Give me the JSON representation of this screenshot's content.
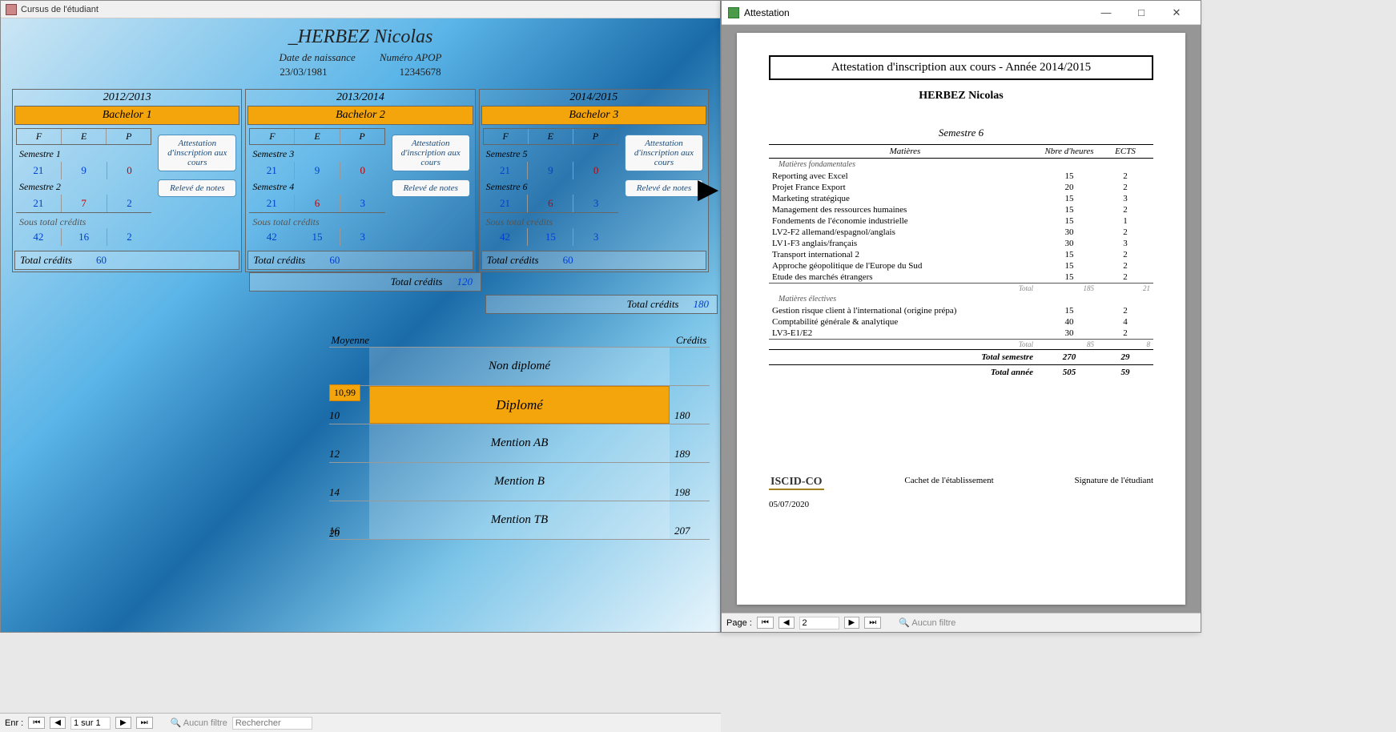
{
  "main": {
    "window_title": "Cursus de l'étudiant",
    "student_name": "_HERBEZ Nicolas",
    "dob_label": "Date de naissance",
    "dob_value": "23/03/1981",
    "apop_label": "Numéro APOP",
    "apop_value": "12345678",
    "years": [
      {
        "year": "2012/2013",
        "bach": "Bachelor 1",
        "sem_a": "Semestre 1",
        "sa_f": "21",
        "sa_e": "9",
        "sa_p": "0",
        "sem_b": "Semestre 2",
        "sb_f": "21",
        "sb_e": "7",
        "sb_p": "2",
        "sub_label": "Sous total crédits",
        "st_f": "42",
        "st_e": "16",
        "st_p": "2",
        "total_label": "Total crédits",
        "total": "60"
      },
      {
        "year": "2013/2014",
        "bach": "Bachelor 2",
        "sem_a": "Semestre 3",
        "sa_f": "21",
        "sa_e": "9",
        "sa_p": "0",
        "sem_b": "Semestre 4",
        "sb_f": "21",
        "sb_e": "6",
        "sb_p": "3",
        "sub_label": "Sous total crédits",
        "st_f": "42",
        "st_e": "15",
        "st_p": "3",
        "total_label": "Total crédits",
        "total": "60"
      },
      {
        "year": "2014/2015",
        "bach": "Bachelor 3",
        "sem_a": "Semestre 5",
        "sa_f": "21",
        "sa_e": "9",
        "sa_p": "0",
        "sem_b": "Semestre 6",
        "sb_f": "21",
        "sb_e": "6",
        "sb_p": "3",
        "sub_label": "Sous total crédits",
        "st_f": "42",
        "st_e": "15",
        "st_p": "3",
        "total_label": "Total crédits",
        "total": "60"
      }
    ],
    "fep": {
      "f": "F",
      "e": "E",
      "p": "P"
    },
    "btn_attest": "Attestation d'inscription aux cours",
    "btn_releve": "Relevé de notes",
    "cum120_label": "Total crédits",
    "cum120_val": "120",
    "cum180_label": "Total crédits",
    "cum180_val": "180",
    "ladder_hdr_l": "Moyenne",
    "ladder_hdr_r": "Crédits",
    "moy_badge": "10,99",
    "ladder": [
      {
        "left": "",
        "center": "Non diplomé",
        "right": "",
        "hi": false
      },
      {
        "left": "10",
        "center": "Diplomé",
        "right": "180",
        "hi": true
      },
      {
        "left": "12",
        "center": "Mention AB",
        "right": "189",
        "hi": false
      },
      {
        "left": "14",
        "center": "Mention B",
        "right": "198",
        "hi": false
      },
      {
        "left": "16",
        "center": "Mention TB",
        "right": "207",
        "hi": false
      },
      {
        "left": "20",
        "center": "",
        "right": "",
        "hi": false
      }
    ],
    "status": {
      "enr_label": "Enr :",
      "page_pos": "1 sur 1",
      "filter": "Aucun filtre",
      "search": "Rechercher"
    }
  },
  "att": {
    "window_title": "Attestation",
    "title": "Attestation d'inscription aux cours - Année  2014/2015",
    "student": "HERBEZ Nicolas",
    "semester": "Semestre 6",
    "th_mat": "Matières",
    "th_h": "Nbre d'heures",
    "th_e": "ECTS",
    "cat_fond": "Matières fondamentales",
    "fond": [
      {
        "m": "Reporting avec Excel",
        "h": "15",
        "e": "2"
      },
      {
        "m": "Projet France Export",
        "h": "20",
        "e": "2"
      },
      {
        "m": "Marketing stratégique",
        "h": "15",
        "e": "3"
      },
      {
        "m": "Management des ressources humaines",
        "h": "15",
        "e": "2"
      },
      {
        "m": "Fondements de l'économie industrielle",
        "h": "15",
        "e": "1"
      },
      {
        "m": "LV2-F2 allemand/espagnol/anglais",
        "h": "30",
        "e": "2"
      },
      {
        "m": "LV1-F3 anglais/français",
        "h": "30",
        "e": "3"
      },
      {
        "m": "Transport international 2",
        "h": "15",
        "e": "2"
      },
      {
        "m": "Approche géopolitique de l'Europe du Sud",
        "h": "15",
        "e": "2"
      },
      {
        "m": "Etude des marchés étrangers",
        "h": "15",
        "e": "2"
      }
    ],
    "sub_fond_lbl": "Total",
    "sub_fond_h": "185",
    "sub_fond_e": "21",
    "cat_elec": "Matières électives",
    "elec": [
      {
        "m": "Gestion risque client à l'international (origine prépa)",
        "h": "15",
        "e": "2"
      },
      {
        "m": "Comptabilité générale & analytique",
        "h": "40",
        "e": "4"
      },
      {
        "m": "LV3-E1/E2",
        "h": "30",
        "e": "2"
      }
    ],
    "sub_elec_lbl": "Total",
    "sub_elec_h": "85",
    "sub_elec_e": "8",
    "tot_sem_lbl": "Total semestre",
    "tot_sem_h": "270",
    "tot_sem_e": "29",
    "tot_an_lbl": "Total année",
    "tot_an_h": "505",
    "tot_an_e": "59",
    "cachet": "Cachet de l'établissement",
    "signature": "Signature de l'étudiant",
    "logo": "ISCID-CO",
    "date": "05/07/2020",
    "status": {
      "page_label": "Page :",
      "page_pos": "2",
      "filter": "Aucun filtre"
    }
  }
}
